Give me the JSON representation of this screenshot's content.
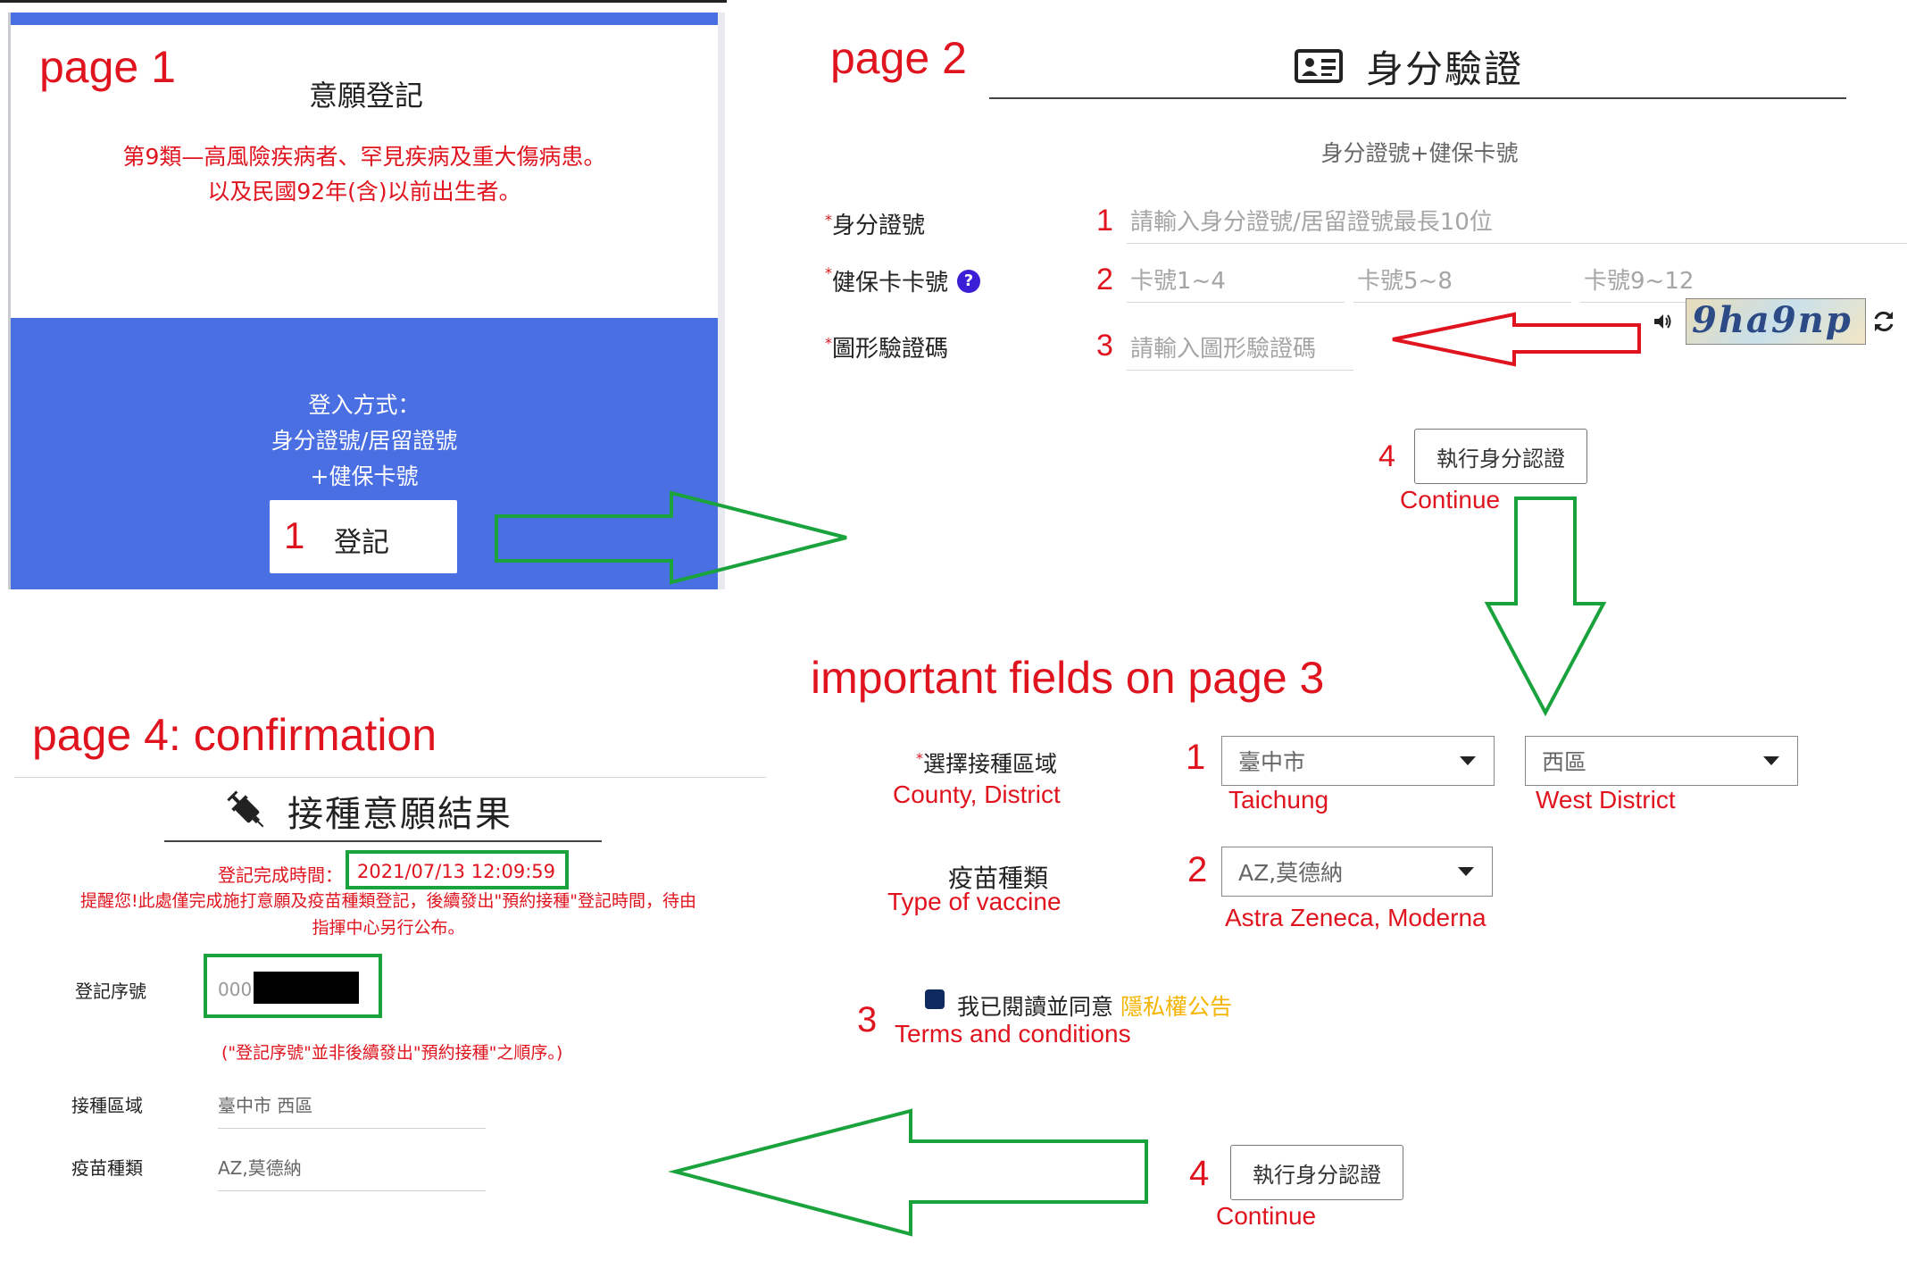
{
  "page1": {
    "annotation": "page 1",
    "title": "意願登記",
    "description_line1": "第9類—高風險疾病者、罕見疾病及重大傷病患。",
    "description_line2": "以及民國92年(含)以前出生者。",
    "login_heading": "登入方式：",
    "login_method_line1": "身分證號/居留證號",
    "login_method_line2": "+健保卡號",
    "register_step": "1",
    "register_button": "登記"
  },
  "page2": {
    "annotation": "page 2",
    "title": "身分驗證",
    "subtitle": "身分證號+健保卡號",
    "required_mark": "*",
    "id_label": "身分證號",
    "id_step": "1",
    "id_placeholder": "請輸入身分證號/居留證號最長10位",
    "card_label": "健保卡卡號",
    "card_help_icon": "?",
    "card_step": "2",
    "card_placeholder_1": "卡號1~4",
    "card_placeholder_2": "卡號5~8",
    "card_placeholder_3": "卡號9~12",
    "captcha_label": "圖形驗證碼",
    "captcha_step": "3",
    "captcha_placeholder": "請輸入圖形驗證碼",
    "captcha_text": "9ha9np",
    "submit_step": "4",
    "submit_button": "執行身分認證",
    "submit_caption": "Continue"
  },
  "page3": {
    "annotation": "important fields on page 3",
    "required_mark": "*",
    "region_label": "選擇接種區域",
    "region_caption": "County, District",
    "region_step": "1",
    "county_value": "臺中市",
    "county_caption": "Taichung",
    "district_value": "西區",
    "district_caption": "West District",
    "vaccine_label": "疫苗種類",
    "vaccine_caption": "Type of vaccine",
    "vaccine_step": "2",
    "vaccine_value": "AZ,莫德納",
    "vaccine_value_caption": "Astra Zeneca, Moderna",
    "terms_step": "3",
    "terms_text": "我已閱讀並同意",
    "terms_link": "隱私權公告",
    "terms_caption": "Terms and conditions",
    "submit_step": "4",
    "submit_button": "執行身分認證",
    "submit_caption": "Continue"
  },
  "page4": {
    "annotation": "page 4: confirmation",
    "title": "接種意願結果",
    "completed_label": "登記完成時間：",
    "completed_time": "2021/07/13 12:09:59",
    "notice_line1": "提醒您!此處僅完成施打意願及疫苗種類登記，後續發出\"預約接種\"登記時間，待由",
    "notice_line2": "指揮中心另行公布。",
    "serial_label": "登記序號",
    "serial_value": "000",
    "serial_note": "(\"登記序號\"並非後續發出\"預約接種\"之順序。)",
    "region_label": "接種區域",
    "region_value": "臺中市 西區",
    "vaccine_label": "疫苗種類",
    "vaccine_value": "AZ,莫德納"
  },
  "colors": {
    "annotation_red": "#e0141e",
    "arrow_green": "#1aa33c",
    "primary_blue": "#4a6fe3",
    "checkbox_navy": "#0e2a5e",
    "link_yellow": "#f5b400"
  }
}
